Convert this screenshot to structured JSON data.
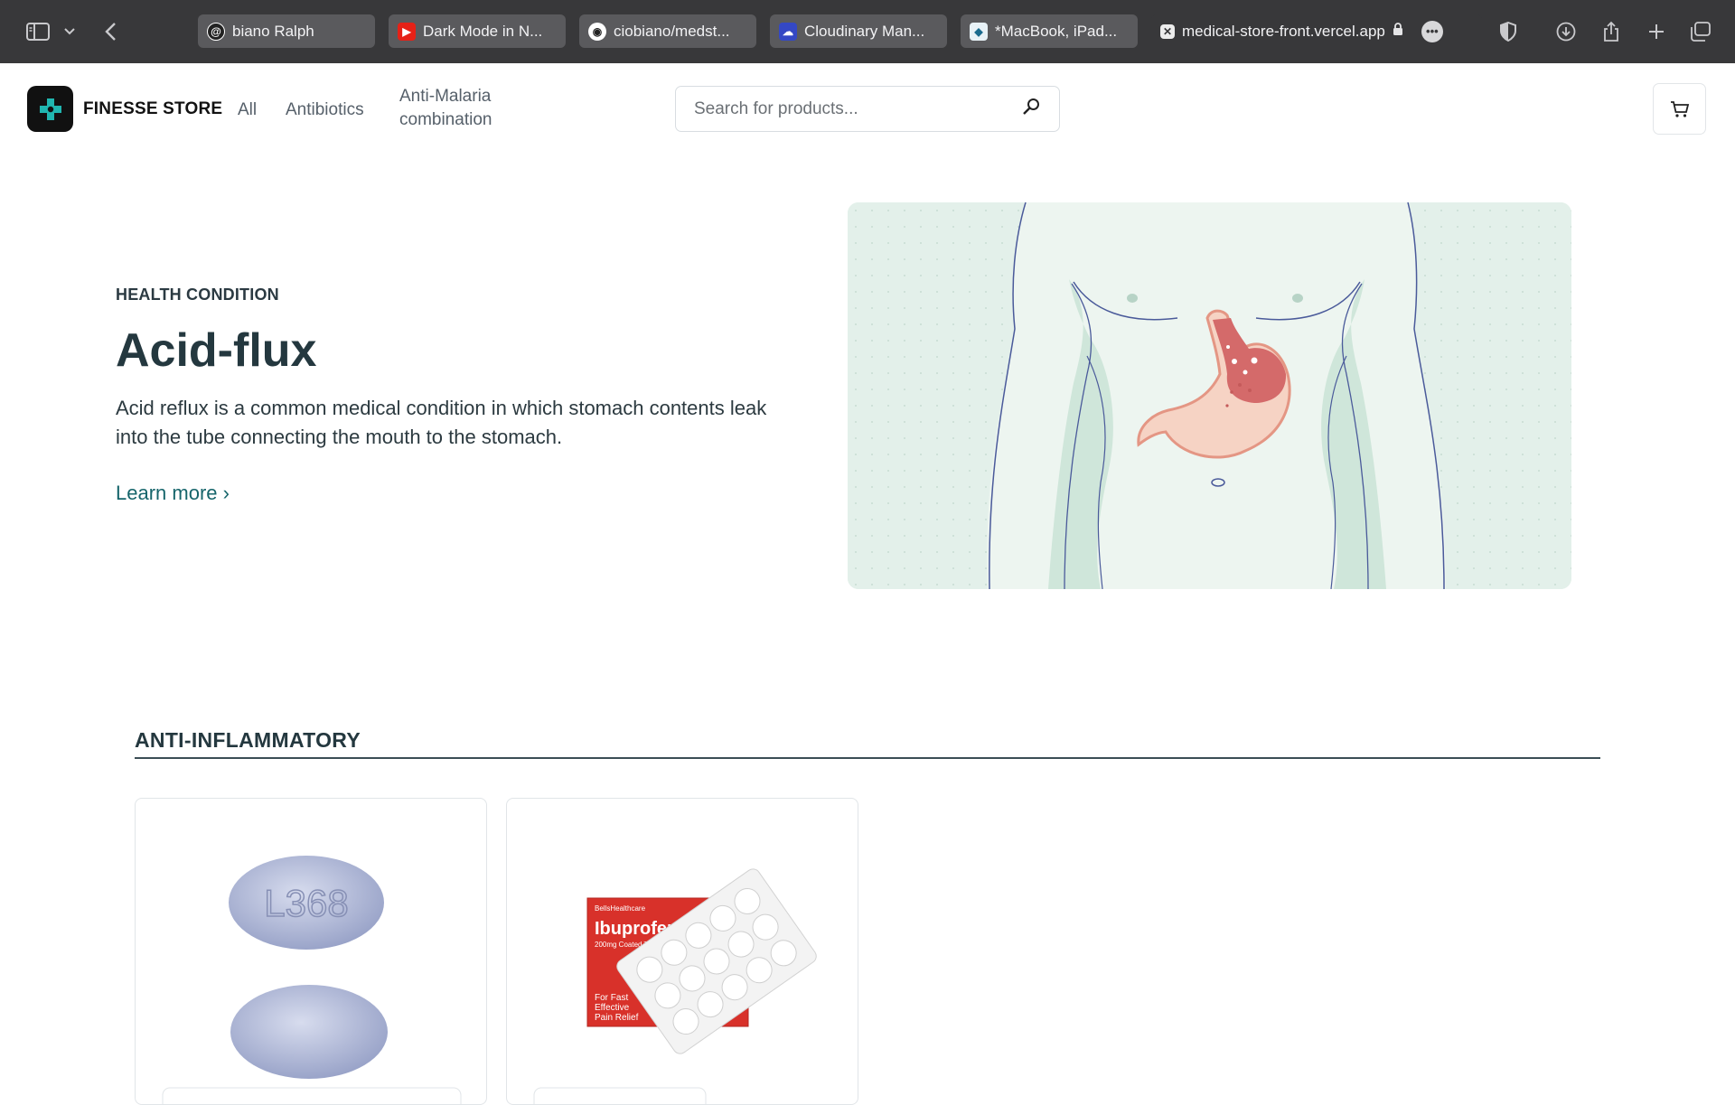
{
  "browser": {
    "tabs": [
      {
        "label": "biano Ralph",
        "icon": "threads-icon"
      },
      {
        "label": "Dark Mode in N...",
        "icon": "youtube-icon"
      },
      {
        "label": "ciobiano/medst...",
        "icon": "github-icon"
      },
      {
        "label": "Cloudinary Man...",
        "icon": "cloudinary-icon"
      },
      {
        "label": "*MacBook, iPad...",
        "icon": "site-icon"
      },
      {
        "label": "medical-store-front.vercel.app",
        "icon": "close-tab-icon",
        "active": true
      }
    ]
  },
  "header": {
    "brand": "FINESSE STORE",
    "nav": [
      "All",
      "Antibiotics",
      "Anti-Malaria",
      "combination"
    ],
    "search": {
      "placeholder": "Search for products..."
    }
  },
  "hero": {
    "eyebrow": "HEALTH CONDITION",
    "title": "Acid-flux",
    "description": "Acid reflux is a common medical condition in which stomach contents leak into the tube connecting the mouth to the stomach.",
    "cta": "Learn more ›"
  },
  "section": {
    "title": "ANTI-INFLAMMATORY",
    "products": [
      {
        "image": "oval-pills-l368",
        "pill_text": "L368"
      },
      {
        "image": "ibuprofen-pack",
        "box_brand": "BellsHealthcare",
        "box_title": "Ibuprofen",
        "box_dose": "200mg Coated Tablets",
        "box_tag1": "For Fast",
        "box_tag2": "Effective",
        "box_tag3": "Pain Relief"
      }
    ]
  },
  "colors": {
    "accent": "#16656b",
    "hero_bg": "#e3f0ea",
    "chrome": "#38383a"
  }
}
